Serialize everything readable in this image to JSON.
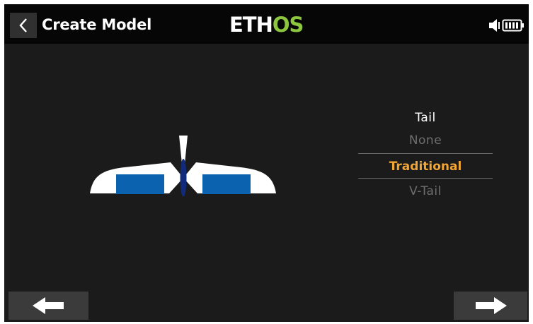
{
  "header": {
    "title": "Create Model",
    "brand_main": "ETH",
    "brand_accent": "OS",
    "brand_accent_color": "#8cc63f",
    "icons": [
      "back-chevron-icon",
      "speaker-icon",
      "battery-icon"
    ]
  },
  "tail_picker": {
    "heading": "Tail",
    "options": [
      {
        "label": "None",
        "selected": false
      },
      {
        "label": "Traditional",
        "selected": true
      },
      {
        "label": "V-Tail",
        "selected": false
      }
    ],
    "selected_color": "#f0a534"
  },
  "navigation": {
    "prev_icon": "arrow-left-icon",
    "next_icon": "arrow-right-icon"
  },
  "colors": {
    "background": "#1c1b1b",
    "header": "#060606",
    "wing": "#ffffff",
    "aileron": "#0b63b0",
    "fuselage": "#122a7a"
  }
}
